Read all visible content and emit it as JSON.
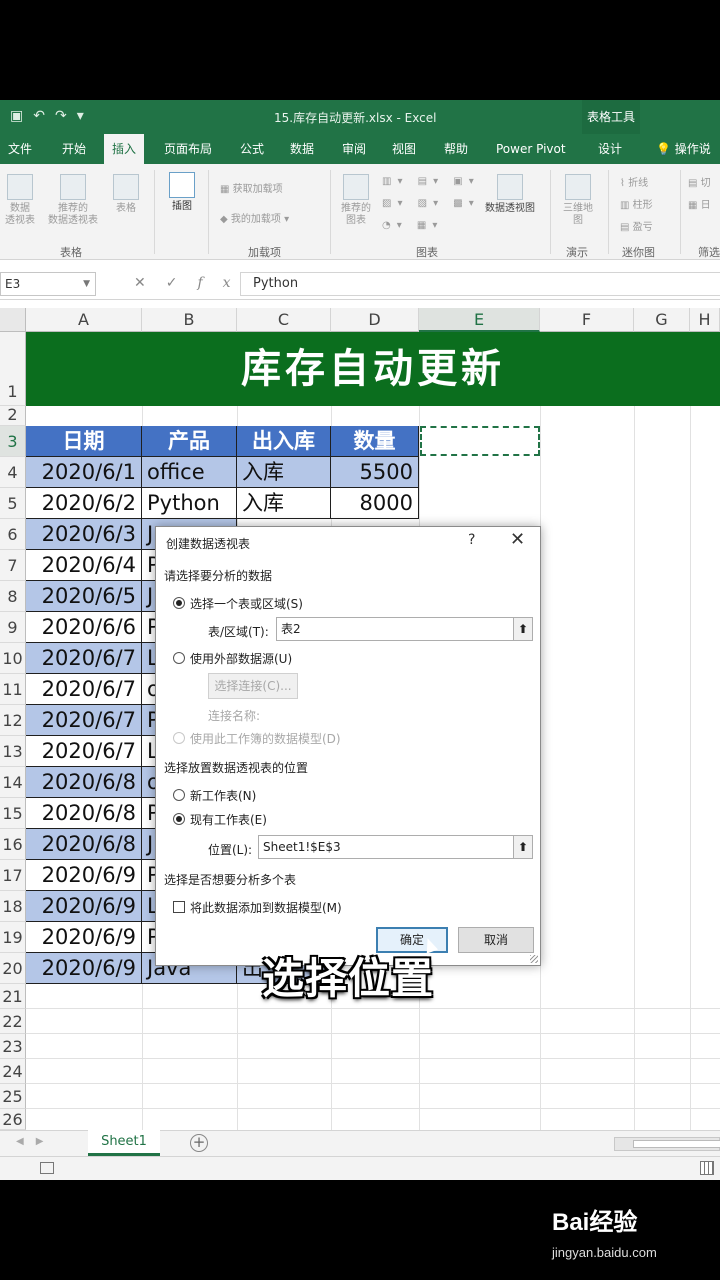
{
  "window": {
    "document_title": "15.库存自动更新.xlsx - Excel",
    "contextual_tab_group": "表格工具"
  },
  "ribbon_tabs": [
    "文件",
    "开始",
    "插入",
    "页面布局",
    "公式",
    "数据",
    "审阅",
    "视图",
    "帮助",
    "Power Pivot",
    "设计"
  ],
  "active_tab": "插入",
  "tell_me": "操作说明",
  "ribbon": {
    "pivot_table": "数据\n透视表",
    "recommended_pivot": "推荐的\n数据透视表",
    "table": "表格",
    "illustrations": "插图",
    "get_addins": "获取加载项",
    "my_addins": "我的加载项",
    "recommended_charts": "推荐的\n图表",
    "pivot_chart": "数据透视图",
    "map_3d": "三维地\n图",
    "sparkline_line": "折线",
    "sparkline_column": "柱形",
    "sparkline_winloss": "盈亏",
    "slicer": "切",
    "timeline": "日",
    "groups": {
      "tables": "表格",
      "addins": "加载项",
      "charts": "图表",
      "tours": "演示",
      "sparklines": "迷你图",
      "filters": "筛选"
    }
  },
  "formula_bar": {
    "name_box": "E3",
    "formula": "Python",
    "cancel": "✕",
    "enter": "✓",
    "fx": "fx"
  },
  "columns": [
    "A",
    "B",
    "C",
    "D",
    "E",
    "F",
    "G",
    "H"
  ],
  "rows": [
    "1",
    "2",
    "3",
    "4",
    "5",
    "6",
    "7",
    "8",
    "9",
    "10",
    "11",
    "12",
    "13",
    "14",
    "15",
    "16",
    "17",
    "18",
    "19",
    "20",
    "21",
    "22",
    "23",
    "24",
    "25",
    "26"
  ],
  "banner_title": "库存自动更新",
  "table": {
    "headers": [
      "日期",
      "产品",
      "出入库",
      "数量"
    ],
    "rows": [
      [
        "2020/6/1",
        "office",
        "入库",
        "5500"
      ],
      [
        "2020/6/2",
        "Python",
        "入库",
        "8000"
      ],
      [
        "2020/6/3",
        "J",
        "",
        ""
      ],
      [
        "2020/6/4",
        "P",
        "",
        ""
      ],
      [
        "2020/6/5",
        "J",
        "",
        ""
      ],
      [
        "2020/6/6",
        "P",
        "",
        ""
      ],
      [
        "2020/6/7",
        "L",
        "",
        ""
      ],
      [
        "2020/6/7",
        "o",
        "",
        ""
      ],
      [
        "2020/6/7",
        "P",
        "",
        ""
      ],
      [
        "2020/6/7",
        "L",
        "",
        ""
      ],
      [
        "2020/6/8",
        "o",
        "",
        ""
      ],
      [
        "2020/6/8",
        "P",
        "",
        ""
      ],
      [
        "2020/6/8",
        "J",
        "",
        ""
      ],
      [
        "2020/6/9",
        "P",
        "",
        ""
      ],
      [
        "2020/6/9",
        "L",
        "",
        ""
      ],
      [
        "2020/6/9",
        "P",
        "",
        ""
      ],
      [
        "2020/6/9",
        "Java",
        "出",
        ""
      ]
    ]
  },
  "dialog": {
    "title": "创建数据透视表",
    "help": "?",
    "close": "✕",
    "section1": "请选择要分析的数据",
    "opt_table_range": "选择一个表或区域(S)",
    "table_range_label": "表/区域(T):",
    "table_range_value": "表2",
    "opt_external": "使用外部数据源(U)",
    "choose_connection": "选择连接(C)...",
    "connection_name": "连接名称:",
    "opt_data_model": "使用此工作簿的数据模型(D)",
    "section2": "选择放置数据透视表的位置",
    "opt_new_sheet": "新工作表(N)",
    "opt_existing_sheet": "现有工作表(E)",
    "location_label": "位置(L):",
    "location_value": "Sheet1!$E$3",
    "section3": "选择是否想要分析多个表",
    "add_to_model": "将此数据添加到数据模型(M)",
    "ok": "确定",
    "cancel": "取消",
    "picker_glyph": "⬆"
  },
  "sheet_tab": "Sheet1",
  "add_sheet": "+",
  "subtitle_caption": "选择位置",
  "watermark": {
    "brand": "Bai经验",
    "url": "jingyan.baidu.com"
  },
  "colors": {
    "excel_green": "#217346",
    "banner_green": "#0b6e1e",
    "header_blue": "#4472c4",
    "band_blue": "#b4c6e7"
  }
}
